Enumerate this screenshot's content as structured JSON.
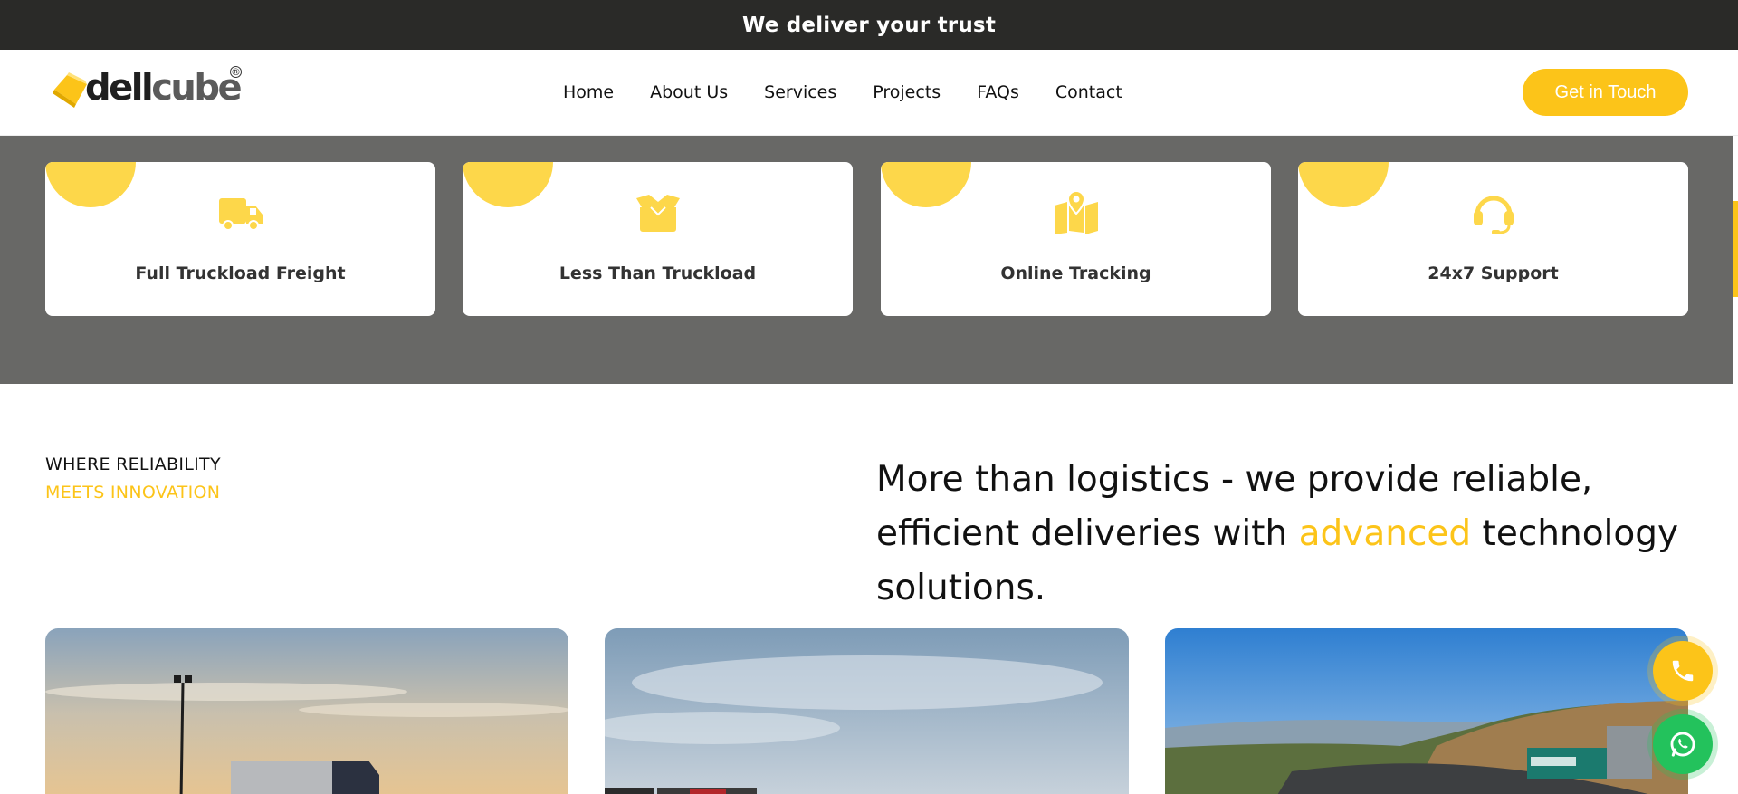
{
  "topbar": {
    "text": "We deliver your trust"
  },
  "logo": {
    "part1": "dell",
    "part2": "cube",
    "mark": "®"
  },
  "nav": [
    "Home",
    "About Us",
    "Services",
    "Projects",
    "FAQs",
    "Contact"
  ],
  "cta": "Get in Touch",
  "features": [
    {
      "label": "Full Truckload Freight",
      "icon": "truck-icon"
    },
    {
      "label": "Less Than Truckload",
      "icon": "open-box-icon"
    },
    {
      "label": "Online Tracking",
      "icon": "map-pin-icon"
    },
    {
      "label": "24x7 Support",
      "icon": "headset-icon"
    }
  ],
  "section": {
    "tag1": "WHERE RELIABILITY",
    "tag2": "MEETS INNOVATION",
    "headline_pre": "More than logistics - we provide reliable, efficient deliveries with ",
    "headline_highlight": "advanced",
    "headline_post": " technology solutions."
  },
  "colors": {
    "accent": "#fcc419",
    "dark": "#2a2a28",
    "band": "#686866",
    "whatsapp": "#23c25c"
  },
  "floating": {
    "phone_icon": "phone-icon",
    "whatsapp_icon": "whatsapp-icon"
  }
}
